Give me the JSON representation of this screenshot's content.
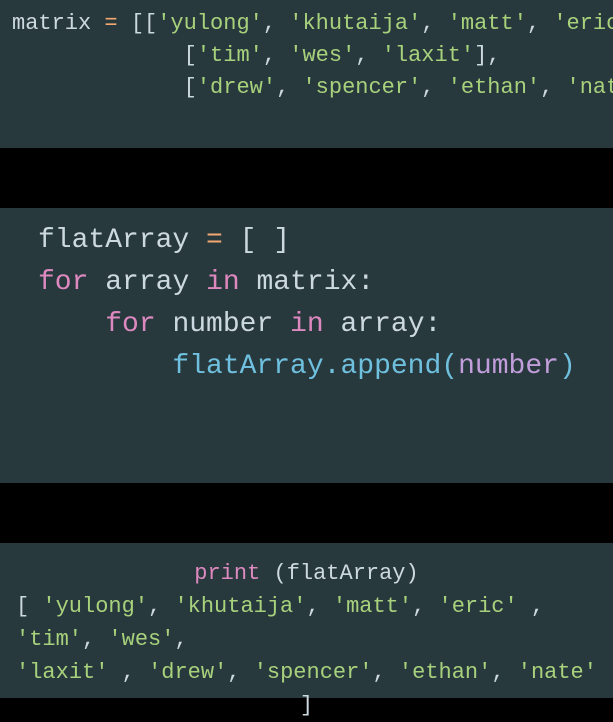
{
  "block1": {
    "matrix_var": "matrix ",
    "eq": "= ",
    "row1": {
      "open": "[[",
      "v1": "'yulong'",
      "c": ", ",
      "v2": "'khutaija'",
      "v3": "'matt'",
      "v4": "'eric'",
      "close": "],"
    },
    "row2": {
      "indent": "             ",
      "open": "[",
      "v1": "'tim'",
      "c": ", ",
      "v2": "'wes'",
      "v3": "'laxit'",
      "close": "],"
    },
    "row3": {
      "indent": "             ",
      "open": "[",
      "v1": "'drew'",
      "c": ", ",
      "v2": "'spencer'",
      "v3": "'ethan'",
      "v4": "'nate'",
      "close": "]]"
    }
  },
  "block2": {
    "line1": {
      "flat": "flatArray ",
      "eq": "= ",
      "brackets": "[ ]"
    },
    "line2": {
      "for": "for",
      "sp1": " ",
      "arr": "array",
      "sp2": " ",
      "in": "in",
      "sp3": " ",
      "matrix": "matrix",
      "colon": ":"
    },
    "line3": {
      "indent": "    ",
      "for": "for",
      "sp1": " ",
      "num": "number",
      "sp2": " ",
      "in": "in",
      "sp3": " ",
      "arr": "array",
      "colon": ":"
    },
    "line4": {
      "indent": "        ",
      "flat": "flatArray",
      "dot": ".",
      "append": "append",
      "open": "(",
      "num": "number",
      "close": ")"
    }
  },
  "block3": {
    "line1": {
      "print": "print",
      "sp": " ",
      "open": "(",
      "flat": "flatArray",
      "close": ")"
    },
    "line2": {
      "open": "[ ",
      "v1": "'yulong'",
      "c": ", ",
      "v2": "'khutaija'",
      "v3": "'matt'",
      "v4": "'eric'",
      "sp_c": " ,",
      "v5": "'tim'",
      "v6": "'wes'",
      "close": ","
    },
    "line3": {
      "indent": "",
      "v1": "'laxit'",
      "sp_c": " , ",
      "v2": "'drew'",
      "c": ", ",
      "v3": "'spencer'",
      "v4": "'ethan'",
      "v5": "'nate'",
      "close": " ]"
    }
  }
}
